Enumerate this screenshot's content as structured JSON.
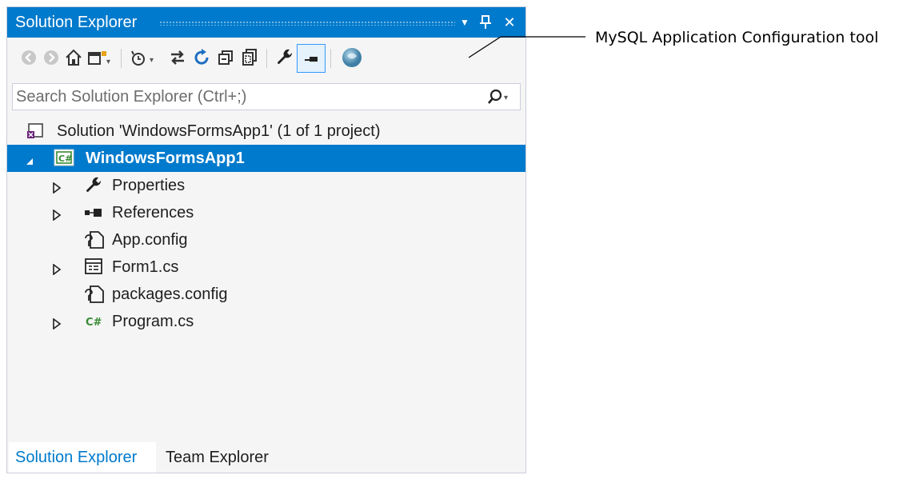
{
  "panel": {
    "title": "Solution Explorer",
    "title_buttons": {
      "dropdown": "▼",
      "pin": "⊥",
      "close": "✕"
    }
  },
  "toolbar": {
    "items": [
      "back-icon",
      "forward-icon",
      "home-icon",
      "switch-views-icon",
      "pending-changes-filter-icon",
      "sync-icon",
      "refresh-icon",
      "collapse-all-icon",
      "show-all-files-icon",
      "properties-wrench-icon",
      "preview-selected-icon",
      "mysql-config-icon"
    ]
  },
  "search": {
    "placeholder": "Search Solution Explorer (Ctrl+;)"
  },
  "tree": {
    "solution": "Solution 'WindowsFormsApp1' (1 of 1 project)",
    "project": "WindowsFormsApp1",
    "items": [
      "Properties",
      "References",
      "App.config",
      "Form1.cs",
      "packages.config",
      "Program.cs"
    ]
  },
  "tabs": {
    "active": "Solution Explorer",
    "inactive": "Team Explorer"
  },
  "callout": {
    "text": "MySQL Application Configuration tool"
  },
  "colors": {
    "accent": "#007acc",
    "csharp": "#388a34",
    "vs_purple": "#68217a"
  }
}
